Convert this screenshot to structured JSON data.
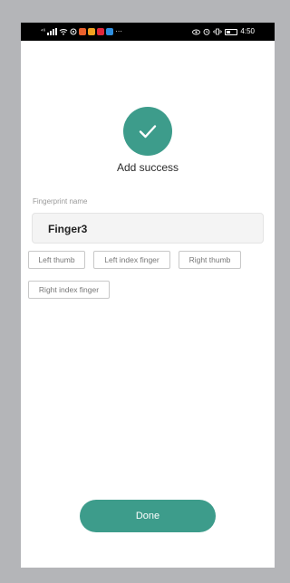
{
  "status_bar": {
    "signal_label": "⁴⁶",
    "more": "···",
    "time": "4:50",
    "app_colors": [
      "#e8602c",
      "#f0a020",
      "#e0283c",
      "#2f8fe0"
    ]
  },
  "result": {
    "icon": "checkmark-icon",
    "accent_color": "#3d9c8b",
    "message": "Add success"
  },
  "form": {
    "label": "Fingerprint name",
    "value": "Finger3"
  },
  "presets": [
    {
      "label": "Left thumb"
    },
    {
      "label": "Left index finger"
    },
    {
      "label": "Right thumb"
    },
    {
      "label": "Right index finger"
    }
  ],
  "actions": {
    "done_label": "Done"
  }
}
